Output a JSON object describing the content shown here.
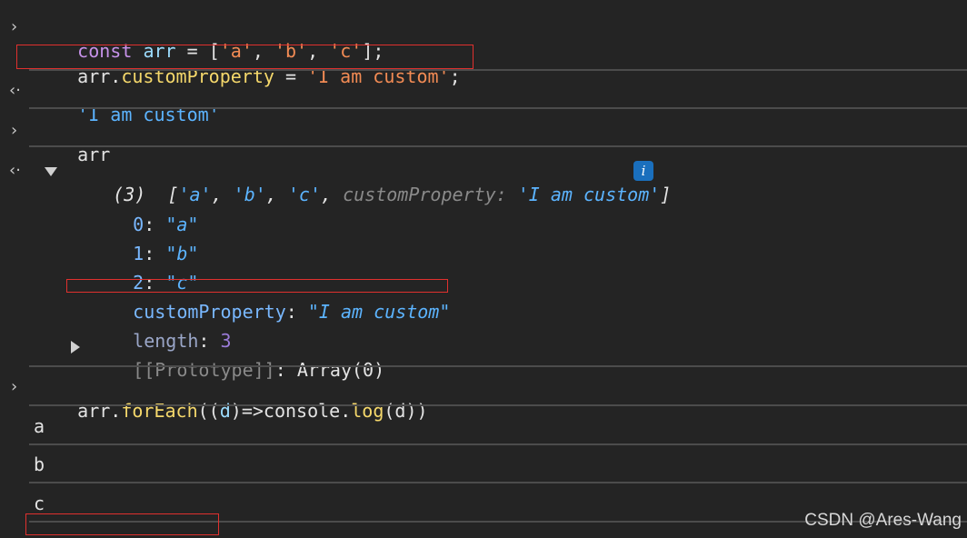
{
  "entries": {
    "input1": {
      "prompt": "›",
      "line1": {
        "kw": "const",
        "ident": "arr",
        "eq": "=",
        "open": "[",
        "s1": "'a'",
        "c1": ",",
        "s2": "'b'",
        "c2": ",",
        "s3": "'c'",
        "close": "];"
      },
      "line2": {
        "obj": "arr",
        "dot": ".",
        "prop": "customProperty",
        "eq": "=",
        "str": "'I am custom'",
        "semi": ";"
      }
    },
    "result1": {
      "prompt": "‹·",
      "value": "'I am custom'"
    },
    "input2": {
      "prompt": "›",
      "text": "arr"
    },
    "result2": {
      "prompt": "‹·",
      "count": "(3)",
      "preview": {
        "open": "[",
        "a": "'a'",
        "sep1": ",",
        "b": "'b'",
        "sep2": ",",
        "c": "'c'",
        "sep3": ",",
        "propKey": "customProperty",
        "colon": ":",
        "propVal": "'I am custom'",
        "close": "]"
      },
      "info": "i",
      "items": [
        {
          "key": "0",
          "value": "\"a\""
        },
        {
          "key": "1",
          "value": "\"b\""
        },
        {
          "key": "2",
          "value": "\"c\""
        }
      ],
      "customProperty": {
        "key": "customProperty",
        "value": "\"I am custom\""
      },
      "length": {
        "key": "length",
        "value": "3"
      },
      "prototype": {
        "key": "[[Prototype]]",
        "value": "Array(0)"
      }
    },
    "input3": {
      "prompt": "›",
      "obj": "arr",
      "dot": ".",
      "method": "forEach",
      "p1": "((",
      "arg": "d",
      "p2": ")=>console.",
      "log": "log",
      "p3": "(d))"
    },
    "outputs": [
      "a",
      "b",
      "c"
    ]
  },
  "watermark": "CSDN @Ares-Wang",
  "colors": {
    "background": "#242424",
    "divider": "#4c4c4c",
    "highlight": "#e0302e",
    "string": "#f28b54",
    "keyword": "#c792ea",
    "identifier": "#9cdcfe",
    "property": "#f5d86b"
  }
}
